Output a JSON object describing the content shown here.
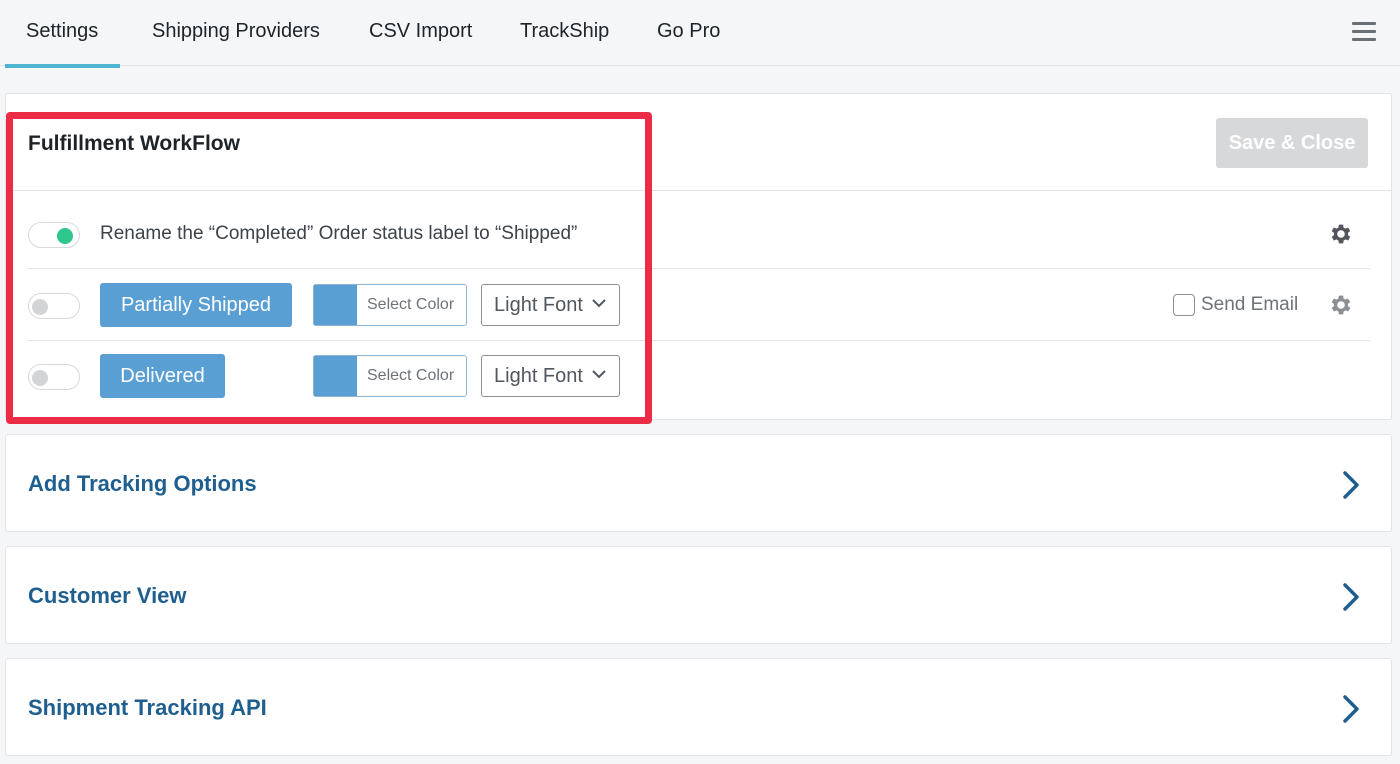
{
  "tabs": [
    {
      "label": "Settings",
      "active": true
    },
    {
      "label": "Shipping Providers",
      "active": false
    },
    {
      "label": "CSV Import",
      "active": false
    },
    {
      "label": "TrackShip",
      "active": false
    },
    {
      "label": "Go Pro",
      "active": false
    }
  ],
  "menu_icon": "hamburger-menu-icon",
  "workflow": {
    "title": "Fulfillment WorkFlow",
    "save_label": "Save & Close",
    "rename_row": {
      "enabled": true,
      "text": "Rename the “Completed” Order status label to “Shipped”",
      "icon": "gear-icon"
    },
    "statuses": [
      {
        "label": "Partially Shipped",
        "enabled": false,
        "color": "#5a9fd4",
        "color_placeholder": "Select Color",
        "font": "Light Font",
        "send_email_label": "Send Email",
        "send_email_checked": false,
        "icon": "gear-icon"
      },
      {
        "label": "Delivered",
        "enabled": false,
        "color": "#5a9fd4",
        "color_placeholder": "Select Color",
        "font": "Light Font"
      }
    ]
  },
  "sections": [
    {
      "title": "Add Tracking Options",
      "icon": "chevron-right-icon"
    },
    {
      "title": "Customer View",
      "icon": "chevron-right-icon"
    },
    {
      "title": "Shipment Tracking API",
      "icon": "chevron-right-icon"
    }
  ],
  "colors": {
    "accent": "#4fb3d2",
    "status_button": "#5a9fd4",
    "toggle_on": "#2fc78c",
    "highlight": "#ec2b47",
    "section_title": "#1f5f8f"
  }
}
